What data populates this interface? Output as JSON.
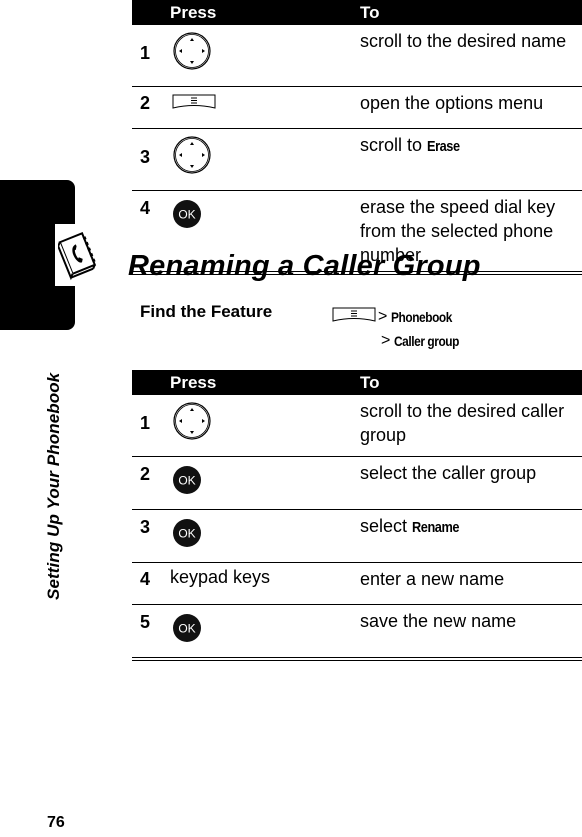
{
  "sidebar": {
    "section_title": "Setting Up Your Phonebook",
    "section_icon": "phonebook-icon"
  },
  "page_number": "76",
  "table1": {
    "headers": {
      "press": "Press",
      "to": "To"
    },
    "rows": [
      {
        "num": "1",
        "press_icon": "nav-key-icon",
        "to": "scroll to the desired name"
      },
      {
        "num": "2",
        "press_icon": "menu-key-icon",
        "to": "open the options menu"
      },
      {
        "num": "3",
        "press_icon": "nav-key-icon",
        "to_prefix": "scroll to ",
        "to_keyword": "Erase"
      },
      {
        "num": "4",
        "press_icon": "ok-key-icon",
        "to": "erase the speed dial key from the selected phone number"
      }
    ]
  },
  "section": {
    "title": "Renaming a Caller Group",
    "find_feature_label": "Find the Feature",
    "find_path": [
      {
        "separator": ">",
        "label": "Phonebook"
      },
      {
        "separator": ">",
        "label": "Caller group"
      }
    ],
    "find_path_icon": "menu-key-icon"
  },
  "table2": {
    "headers": {
      "press": "Press",
      "to": "To"
    },
    "rows": [
      {
        "num": "1",
        "press_icon": "nav-key-icon",
        "to": "scroll to the desired caller group"
      },
      {
        "num": "2",
        "press_icon": "ok-key-icon",
        "to": "select the caller group"
      },
      {
        "num": "3",
        "press_icon": "ok-key-icon",
        "to_prefix": "select ",
        "to_keyword": "Rename"
      },
      {
        "num": "4",
        "press_text": "keypad keys",
        "to": "enter a new name"
      },
      {
        "num": "5",
        "press_icon": "ok-key-icon",
        "to": "save the new name"
      }
    ]
  },
  "icons": {
    "ok_label": "OK"
  }
}
